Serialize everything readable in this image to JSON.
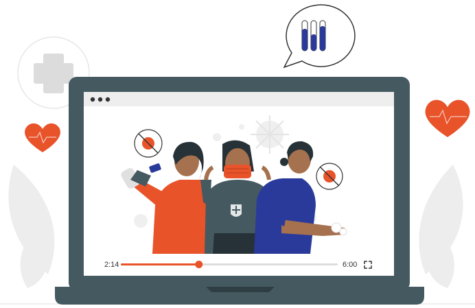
{
  "player": {
    "current_time": "2:14",
    "duration": "6:00",
    "progress": 0.36
  },
  "colors": {
    "accent": "#E8532A",
    "laptop_frame": "#455A60",
    "signal_bar": "#2A3A9B",
    "heart": "#E8532A"
  },
  "icons": [
    "medical-plus-icon",
    "signal-bars-icon",
    "heart-icon",
    "fullscreen-icon",
    "virus-icon",
    "window-dots-icon"
  ]
}
